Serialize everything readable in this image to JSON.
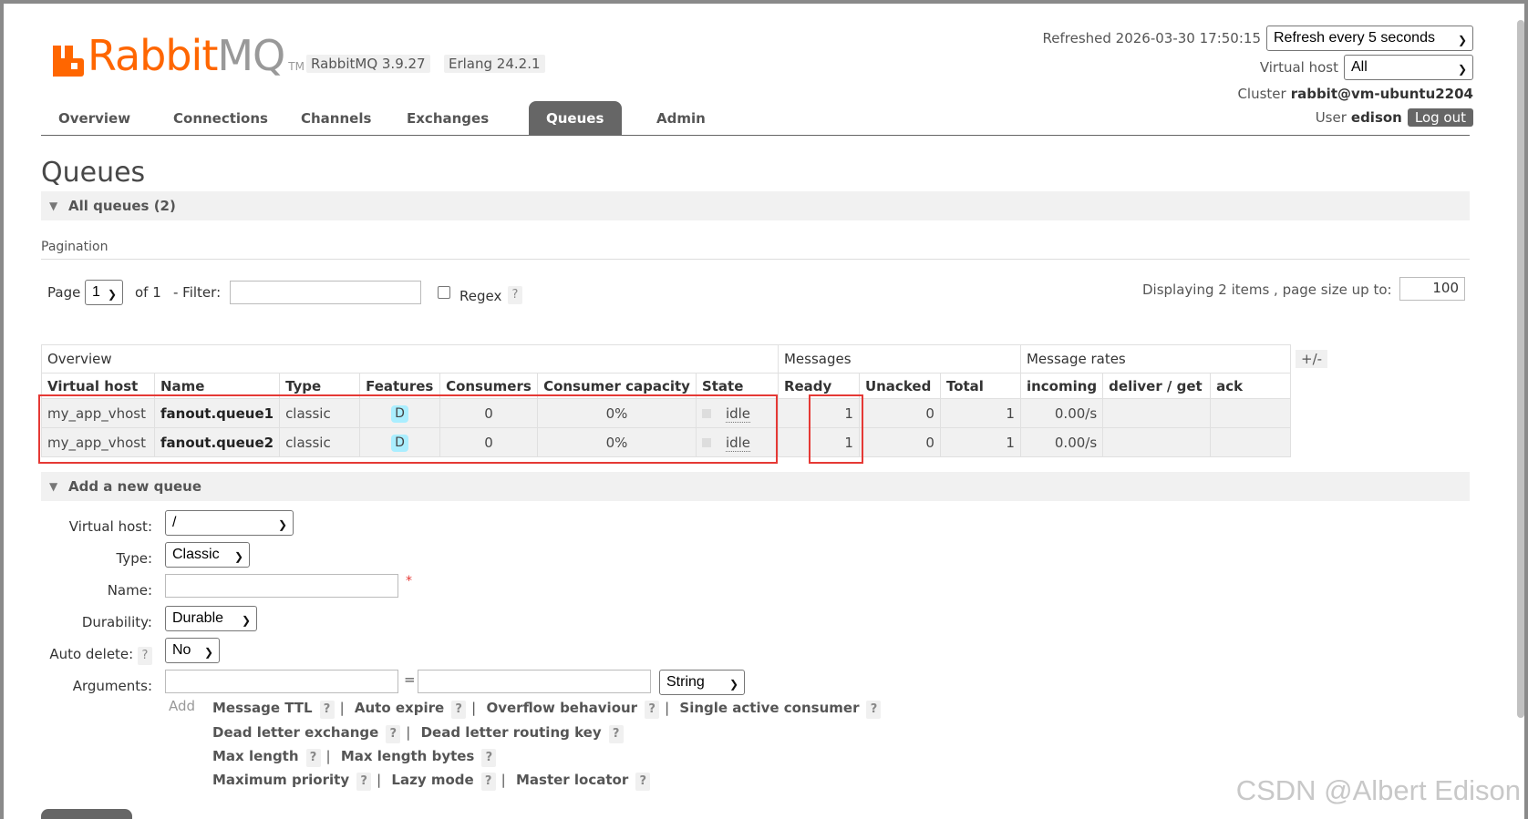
{
  "header": {
    "brand_rabbit": "Rabbit",
    "brand_mq": "MQ",
    "brand_tm": "TM",
    "rabbitmq_version": "RabbitMQ 3.9.27",
    "erlang_version": "Erlang 24.2.1",
    "refreshed_label": "Refreshed 2026-03-30 17:50:15",
    "refresh_select": "Refresh every 5 seconds",
    "vhost_label": "Virtual host",
    "vhost_select": "All",
    "cluster_label": "Cluster",
    "cluster_name": "rabbit@vm-ubuntu2204",
    "user_label": "User",
    "user_name": "edison",
    "logout": "Log out"
  },
  "nav": {
    "tabs": [
      {
        "label": "Overview"
      },
      {
        "label": "Connections"
      },
      {
        "label": "Channels"
      },
      {
        "label": "Exchanges"
      },
      {
        "label": "Queues"
      },
      {
        "label": "Admin"
      }
    ],
    "active": "Queues"
  },
  "page": {
    "title": "Queues",
    "all_queues": "All queues (2)",
    "pagination": "Pagination"
  },
  "pager": {
    "page_label": "Page",
    "page_value": "1",
    "of_label": "of 1",
    "filter_label": "- Filter:",
    "filter_value": "",
    "regex_label": "Regex",
    "help": "?",
    "displaying": "Displaying 2 items , page size up to:",
    "page_size": "100"
  },
  "table": {
    "group_overview": "Overview",
    "group_messages": "Messages",
    "group_rates": "Message rates",
    "plus_minus": "+/-",
    "columns": [
      "Virtual host",
      "Name",
      "Type",
      "Features",
      "Consumers",
      "Consumer capacity",
      "State",
      "Ready",
      "Unacked",
      "Total",
      "incoming",
      "deliver / get",
      "ack"
    ],
    "rows": [
      {
        "vhost": "my_app_vhost",
        "name": "fanout.queue1",
        "type": "classic",
        "feature": "D",
        "consumers": "0",
        "capacity": "0%",
        "state": "idle",
        "ready": "1",
        "unacked": "0",
        "total": "1",
        "incoming": "0.00/s",
        "deliver": "",
        "ack": ""
      },
      {
        "vhost": "my_app_vhost",
        "name": "fanout.queue2",
        "type": "classic",
        "feature": "D",
        "consumers": "0",
        "capacity": "0%",
        "state": "idle",
        "ready": "1",
        "unacked": "0",
        "total": "1",
        "incoming": "0.00/s",
        "deliver": "",
        "ack": ""
      }
    ]
  },
  "add_queue": {
    "title": "Add a new queue",
    "vhost_label": "Virtual host:",
    "vhost_value": "/",
    "type_label": "Type:",
    "type_value": "Classic",
    "name_label": "Name:",
    "name_value": "",
    "required_mark": "*",
    "durability_label": "Durability:",
    "durability_value": "Durable",
    "auto_delete_label": "Auto delete:",
    "auto_delete_value": "No",
    "arguments_label": "Arguments:",
    "equals": "=",
    "arg_type": "String",
    "add_label": "Add",
    "arg_links": [
      [
        "Message TTL",
        "Auto expire",
        "Overflow behaviour",
        "Single active consumer"
      ],
      [
        "Dead letter exchange",
        "Dead letter routing key"
      ],
      [
        "Max length",
        "Max length bytes"
      ],
      [
        "Maximum priority",
        "Lazy mode",
        "Master locator"
      ]
    ]
  },
  "watermark": "CSDN @Albert Edison"
}
